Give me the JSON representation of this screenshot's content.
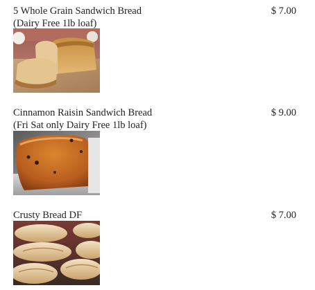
{
  "menu": {
    "items": [
      {
        "name": "5 Whole Grain Sandwich Bread",
        "detail": "(Dairy Free 1lb loaf)",
        "price": "$ 7.00",
        "photo": "whole-grain-loaf-photo"
      },
      {
        "name": "Cinnamon Raisin Sandwich Bread",
        "detail": "(Fri Sat only Dairy Free 1lb loaf)",
        "price": "$ 9.00",
        "photo": "cinnamon-raisin-loaf-photo"
      },
      {
        "name": "Crusty Bread DF",
        "detail": "",
        "price": "$ 7.00",
        "photo": "crusty-bread-photo"
      }
    ]
  }
}
